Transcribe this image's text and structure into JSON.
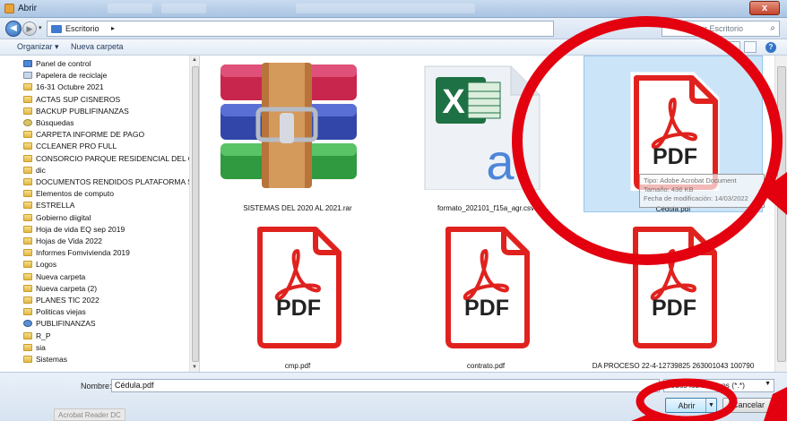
{
  "window": {
    "title": "Abrir",
    "close_label": "x"
  },
  "addressbar": {
    "path": "Escritorio",
    "separator": "▸",
    "search_placeholder": "Buscar Escritorio"
  },
  "toolbar": {
    "organize_label": "Organizar ▾",
    "new_folder_label": "Nueva carpeta",
    "help_label": "?"
  },
  "sidebar": {
    "items": [
      {
        "label": "Panel de control",
        "icon": "control-panel-icon"
      },
      {
        "label": "Papelera de reciclaje",
        "icon": "recycle-bin-icon"
      },
      {
        "label": "16-31 Octubre 2021",
        "icon": "folder-icon"
      },
      {
        "label": "ACTAS SUP CISNEROS",
        "icon": "folder-icon"
      },
      {
        "label": "BACKUP PUBLIFINANZAS",
        "icon": "folder-icon"
      },
      {
        "label": "Búsquedas",
        "icon": "search-folder-icon"
      },
      {
        "label": "CARPETA INFORME DE PAGO",
        "icon": "folder-icon"
      },
      {
        "label": "CCLEANER PRO FULL",
        "icon": "folder-icon"
      },
      {
        "label": "CONSORCIO PARQUE RESIDENCIAL DEL CAFE",
        "icon": "folder-icon"
      },
      {
        "label": "dic",
        "icon": "folder-icon"
      },
      {
        "label": "DOCUMENTOS RENDIDOS PLATAFORMA SIA CON",
        "icon": "folder-icon"
      },
      {
        "label": "Elementos de computo",
        "icon": "folder-icon"
      },
      {
        "label": "ESTRELLA",
        "icon": "folder-icon"
      },
      {
        "label": "Gobierno diigital",
        "icon": "folder-icon"
      },
      {
        "label": "Hoja de vida EQ sep 2019",
        "icon": "folder-icon"
      },
      {
        "label": "Hojas de Vida 2022",
        "icon": "folder-icon"
      },
      {
        "label": "Informes Fomvivienda 2019",
        "icon": "folder-icon"
      },
      {
        "label": "Logos",
        "icon": "folder-icon"
      },
      {
        "label": "Nueva carpeta",
        "icon": "folder-icon"
      },
      {
        "label": "Nueva carpeta (2)",
        "icon": "folder-icon"
      },
      {
        "label": "PLANES TIC 2022",
        "icon": "folder-icon"
      },
      {
        "label": "Politicas viejas",
        "icon": "folder-icon"
      },
      {
        "label": "PUBLIFINANZAS",
        "icon": "network-folder-icon"
      },
      {
        "label": "R_P",
        "icon": "folder-icon"
      },
      {
        "label": "sia",
        "icon": "folder-icon"
      },
      {
        "label": "Sistemas",
        "icon": "folder-icon"
      }
    ]
  },
  "files": [
    {
      "name": "SISTEMAS DEL 2020 AL 2021.rar",
      "type": "rar",
      "selected": false
    },
    {
      "name": "formato_202101_f15a_agr.csv",
      "type": "csv",
      "selected": false
    },
    {
      "name": "Cédula.pdf",
      "type": "pdf",
      "selected": true
    },
    {
      "name": "cmp.pdf",
      "type": "pdf",
      "selected": false
    },
    {
      "name": "contrato.pdf",
      "type": "pdf",
      "selected": false
    },
    {
      "name": "DA PROCESO 22-4-12739825 263001043 100790",
      "type": "pdf",
      "selected": false
    }
  ],
  "pdf_icon_text": "PDF",
  "csv_icon_letter": "a",
  "tooltip": {
    "line1": "Tipo: Adobe Acrobat Document",
    "line2": "Tamaño: 436 KB",
    "line3": "Fecha de modificación: 14/03/2022"
  },
  "bottom": {
    "filename_label": "Nombre:",
    "filename_value": "Cédula.pdf",
    "filter_value": "Todos los archivos (*.*)",
    "open_label": "Abrir",
    "cancel_label": "Cancelar",
    "taskbar_hint": "Acrobat Reader DC"
  },
  "colors": {
    "annotation": "#e3000f",
    "pdf_red": "#e0221e",
    "selection": "#cce4f7"
  }
}
